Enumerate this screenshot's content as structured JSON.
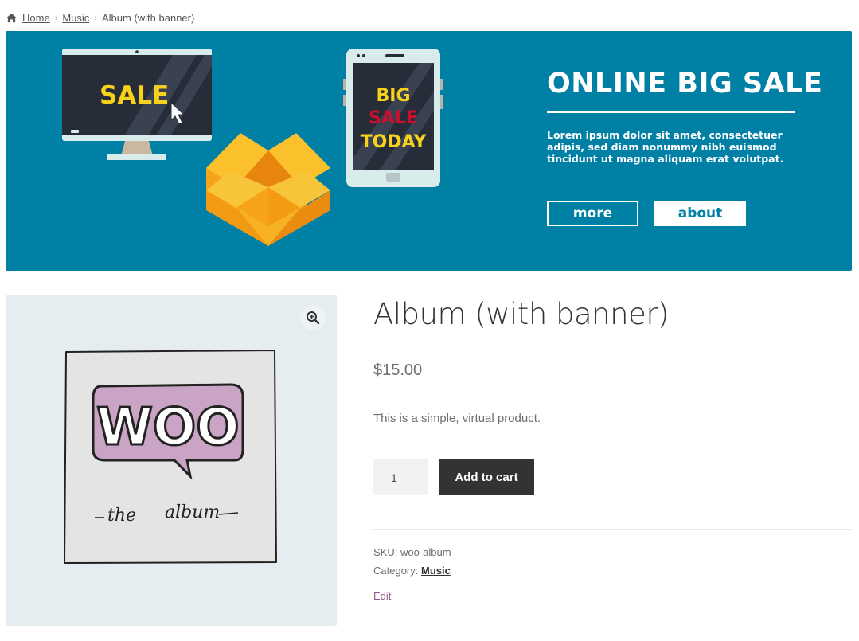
{
  "breadcrumb": {
    "icon": "home-icon",
    "items": [
      "Home",
      "Music"
    ],
    "current": "Album (with banner)"
  },
  "banner": {
    "title": "ONLINE BIG SALE",
    "text": "Lorem ipsum dolor sit amet, consectetuer adipis, sed diam nonummy nibh euismod tincidunt ut magna aliquam erat volutpat.",
    "more_label": "more",
    "about_label": "about",
    "monitor_text": "SALE",
    "phone_text": [
      "BIG",
      "SALE",
      "TODAY"
    ],
    "colors": {
      "background": "#0180a5",
      "yellow": "#f7d21b",
      "red": "#c8102e"
    }
  },
  "product": {
    "title": "Album (with banner)",
    "price": "$15.00",
    "description": "This is a simple, virtual product.",
    "quantity": "1",
    "add_to_cart_label": "Add to cart",
    "sku_label": "SKU:",
    "sku": "woo-album",
    "category_label": "Category:",
    "category": "Music",
    "edit_label": "Edit",
    "image_text": {
      "logo": "WOO",
      "caption_left": "the",
      "caption_right": "album"
    }
  },
  "icons": {
    "zoom": "zoom-in-icon"
  }
}
